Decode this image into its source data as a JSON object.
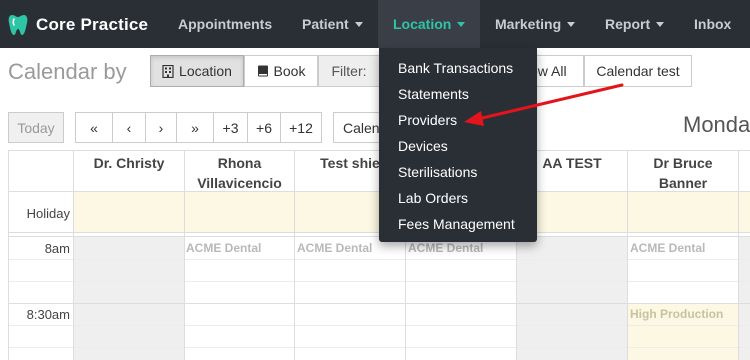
{
  "navbar": {
    "brand": "Core Practice",
    "items": [
      {
        "label": "Appointments",
        "caret": false
      },
      {
        "label": "Patient",
        "caret": true
      },
      {
        "label": "Location",
        "caret": true,
        "active": true
      },
      {
        "label": "Marketing",
        "caret": true
      },
      {
        "label": "Report",
        "caret": true
      },
      {
        "label": "Inbox",
        "caret": false
      }
    ],
    "active_color": "#2ec4a6"
  },
  "toolbar": {
    "title": "Calendar by",
    "location_label": "Location",
    "book_label": "Book",
    "filter_label": "Filter:",
    "show_all_label": "ow All",
    "calendar_test_label": "Calendar test",
    "today_label": "Today",
    "nav": [
      "«",
      "‹",
      "›",
      "»",
      "+3",
      "+6",
      "+12"
    ],
    "calendar_button_label": "Calen",
    "day_title": "Monda"
  },
  "location_menu": {
    "items": [
      "Bank Transactions",
      "Statements",
      "Providers",
      "Devices",
      "Sterilisations",
      "Lab Orders",
      "Fees Management"
    ],
    "highlighted": "Providers"
  },
  "grid": {
    "columns": [
      "Dr. Christy",
      "Rhona Villavicencio",
      "Test shie",
      "",
      "AA TEST",
      "Dr Bruce Banner",
      ""
    ],
    "holiday_label": "Holiday",
    "times": [
      "8am",
      "8:30am"
    ],
    "appointments": [
      "ACME Dental",
      "ACME Dental",
      "ACME Dental",
      "ACME Dental"
    ],
    "production_label": "High Production"
  },
  "annotation_color": "#e3141c"
}
